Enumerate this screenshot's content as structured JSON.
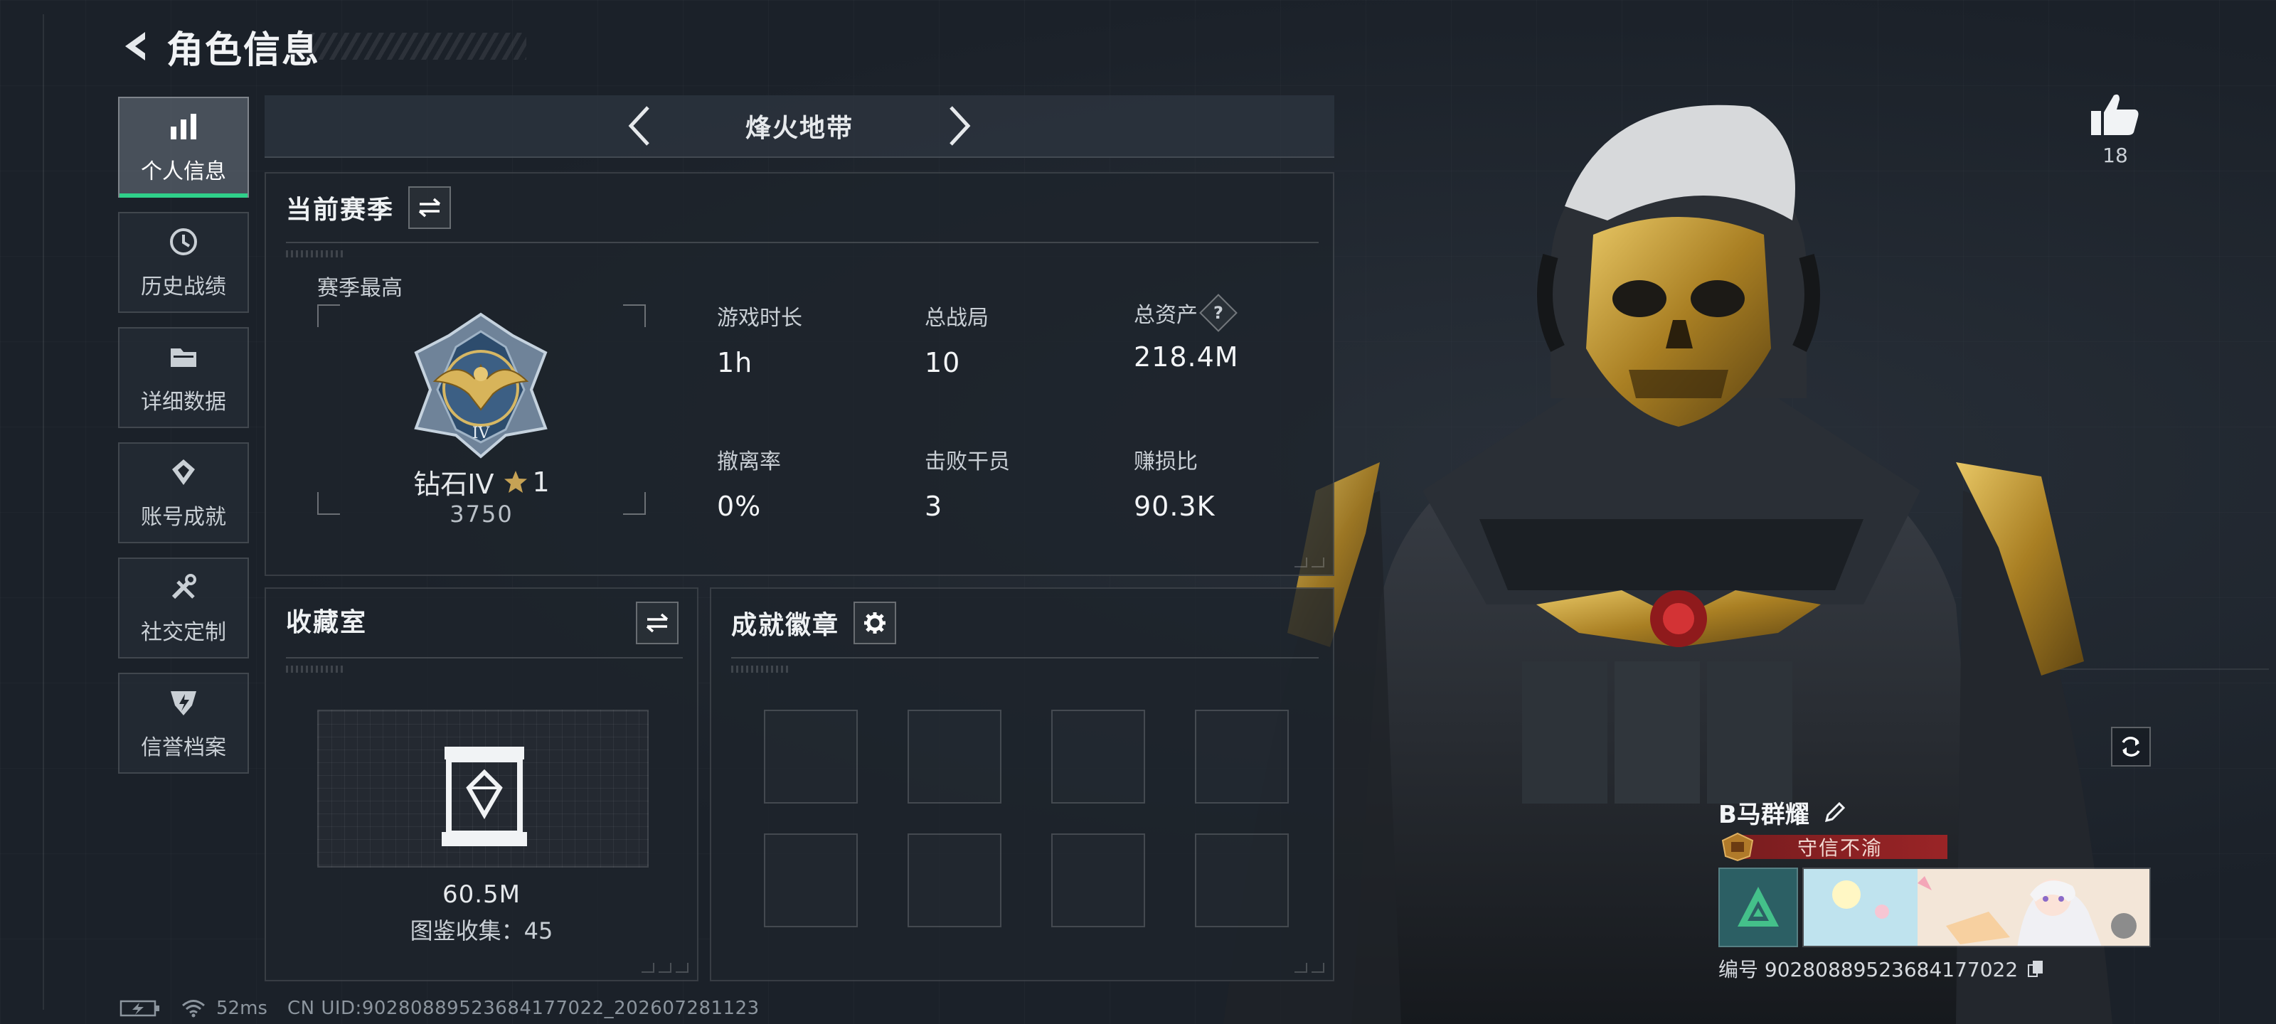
{
  "header": {
    "title": "角色信息"
  },
  "nav": {
    "items": [
      {
        "label": "个人信息",
        "icon": "bar-chart-icon",
        "active": true
      },
      {
        "label": "历史战绩",
        "icon": "history-icon",
        "active": false
      },
      {
        "label": "详细数据",
        "icon": "folder-icon",
        "active": false
      },
      {
        "label": "账号成就",
        "icon": "achievement-icon",
        "active": false
      },
      {
        "label": "社交定制",
        "icon": "tools-icon",
        "active": false
      },
      {
        "label": "信誉档案",
        "icon": "shield-icon",
        "active": false
      }
    ]
  },
  "mode": {
    "title": "烽火地带"
  },
  "season": {
    "title": "当前赛季",
    "rank_label": "赛季最高",
    "rank_name": "钻石IV",
    "rank_stars": "1",
    "rank_score": "3750",
    "stats": [
      {
        "label": "游戏时长",
        "value": "1h"
      },
      {
        "label": "总战局",
        "value": "10"
      },
      {
        "label": "总资产",
        "value": "218.4M",
        "help": "?"
      },
      {
        "label": "撤离率",
        "value": "0%"
      },
      {
        "label": "击败干员",
        "value": "3"
      },
      {
        "label": "赚损比",
        "value": "90.3K"
      }
    ]
  },
  "collection": {
    "title": "收藏室",
    "value": "60.5M",
    "count_text": "图鉴收集：45"
  },
  "achievements": {
    "title": "成就徽章",
    "slot_count": 8
  },
  "likes": {
    "count": "18"
  },
  "player": {
    "name": "B马群耀",
    "title_badge": "守信不渝",
    "id_text": "编号 90280889523684177022"
  },
  "status": {
    "ping": "52ms",
    "uid_line": "CN UID:90280889523684177022_202607281123"
  },
  "colors": {
    "accent_green": "#2fd08a",
    "title_banner_red": "#a02426",
    "gold": "#c9a13b"
  }
}
